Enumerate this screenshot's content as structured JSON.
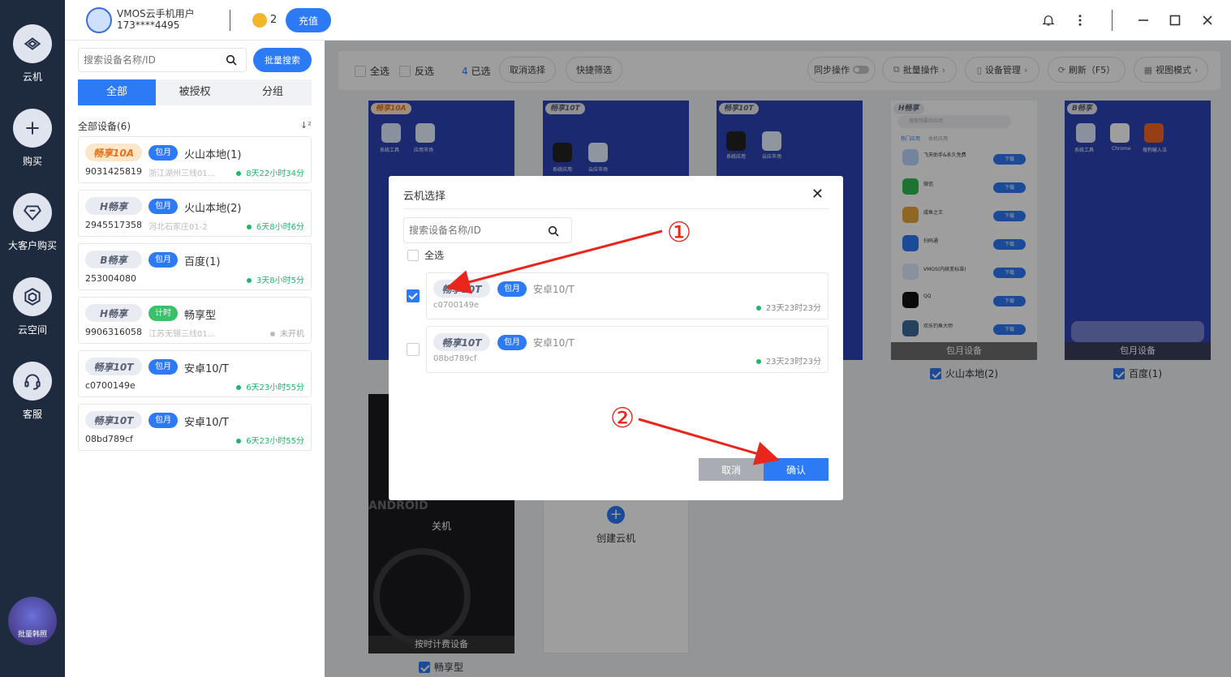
{
  "rail": {
    "items": [
      {
        "label": "云机",
        "icon": "cloud-phone-icon"
      },
      {
        "label": "购买",
        "icon": "plus-icon"
      },
      {
        "label": "大客户购买",
        "icon": "diamond-icon"
      },
      {
        "label": "云空间",
        "icon": "hexagon-icon"
      },
      {
        "label": "客服",
        "icon": "headset-icon"
      }
    ],
    "avatar_text": "批量韩照"
  },
  "topbar": {
    "user_name": "VMOS云手机用户",
    "user_phone": "173****4495",
    "coin_count": "2",
    "recharge_label": "充值"
  },
  "left": {
    "search_placeholder": "搜索设备名称/ID",
    "bulk_search_label": "批量搜索",
    "tabs": [
      "全部",
      "被授权",
      "分组"
    ],
    "list_header": "全部设备(6)",
    "devices": [
      {
        "badge": "畅享10A",
        "plan": "包月",
        "name": "火山本地(1)",
        "id": "9031425819",
        "location": "浙江湖州三线01...",
        "time": "8天22小时34分"
      },
      {
        "badge": "H畅享",
        "plan": "包月",
        "name": "火山本地(2)",
        "id": "2945517358",
        "location": "河北石家庄01-2",
        "time": "6天8小时6分"
      },
      {
        "badge": "B畅享",
        "plan": "包月",
        "name": "百度(1)",
        "id": "253004080",
        "location": "",
        "time": "3天8小时5分"
      },
      {
        "badge": "H畅享",
        "plan": "计时",
        "name": "畅享型",
        "id": "9906316058",
        "location": "江苏无锡三线01...",
        "time": "未开机"
      },
      {
        "badge": "畅享10T",
        "plan": "包月",
        "name": "安卓10/T",
        "id": "c0700149e",
        "location": "",
        "time": "6天23小时55分"
      },
      {
        "badge": "畅享10T",
        "plan": "包月",
        "name": "安卓10/T",
        "id": "08bd789cf",
        "location": "",
        "time": "6天23小时55分"
      }
    ]
  },
  "toolbar": {
    "select_all": "全选",
    "invert": "反选",
    "selected_count": "4",
    "selected_suffix": "已选",
    "cancel_select": "取消选择",
    "quick_filter": "快捷筛选",
    "sync_op": "同步操作",
    "batch_op": "批量操作",
    "device_mgmt": "设备管理",
    "refresh": "刷新（F5）",
    "view_mode": "视图模式"
  },
  "grid": {
    "phones": [
      {
        "tag": "畅享10A",
        "apps": [
          "系统工具",
          "应用市场"
        ]
      },
      {
        "tag": "畅享10T",
        "apps": [
          "系统应用",
          "云应市场"
        ]
      },
      {
        "tag": "畅享10T",
        "apps": [
          "系统应用",
          "云应市场"
        ]
      },
      {
        "tag": "H畅享",
        "footer": "包月设备",
        "label": "火山本地(2)",
        "search": "搜索想要的应用",
        "store_tabs": [
          "热门应用",
          "本机应用"
        ],
        "list": [
          "飞天助手&永久免费",
          "微信",
          "咸鱼之王",
          "扫码通",
          "VMOS(内核变标准)",
          "QQ",
          "欢乐钓鱼大师"
        ],
        "btn": "下载"
      },
      {
        "tag": "B畅享",
        "footer": "包月设备",
        "label": "百度(1)",
        "apps": [
          "系统工具",
          "Chrome",
          "搜狗输入法"
        ]
      }
    ],
    "off_phone": {
      "status": "关机",
      "footer": "按时计费设备",
      "label": "畅享型",
      "wallpaper_text": "ANDROID"
    },
    "create_label": "创建云机"
  },
  "dialog": {
    "title": "云机选择",
    "search_placeholder": "搜索设备名称/ID",
    "select_all": "全选",
    "items": [
      {
        "badge": "畅享10T",
        "plan": "包月",
        "name": "安卓10/T",
        "id": "c0700149e",
        "time": "23天23时23分",
        "checked": true
      },
      {
        "badge": "畅享10T",
        "plan": "包月",
        "name": "安卓10/T",
        "id": "08bd789cf",
        "time": "23天23时23分",
        "checked": false
      }
    ],
    "cancel_label": "取消",
    "confirm_label": "确认"
  },
  "annotations": {
    "step1": "①",
    "step2": "②",
    "arrow_color": "#e8261c"
  }
}
